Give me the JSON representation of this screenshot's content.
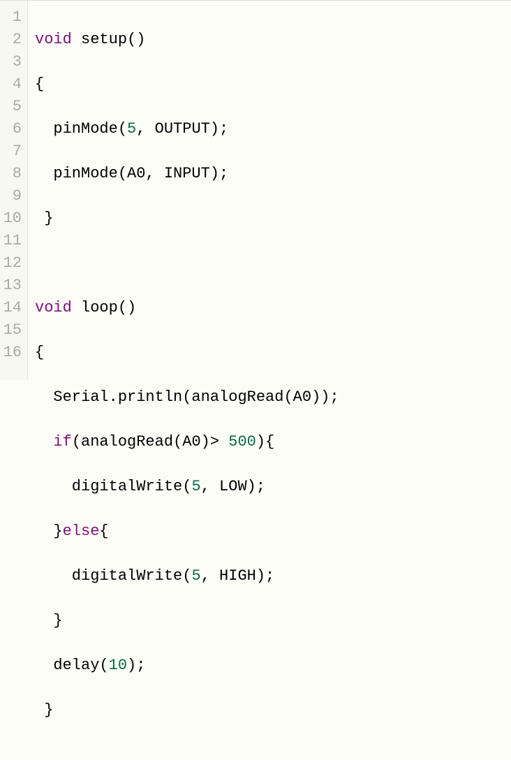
{
  "gutter": [
    "1",
    "2",
    "3",
    "4",
    "5",
    "6",
    "7",
    "8",
    "9",
    "10",
    "11",
    "12",
    "13",
    "14",
    "15",
    "16"
  ],
  "tokens": {
    "void": "void",
    "if": "if",
    "else": "else",
    "five": "5",
    "fiveHundred": "500",
    "ten": "10"
  },
  "code": {
    "l1a": " setup()",
    "l2": "{",
    "l3a": "  pinMode(",
    "l3b": ", OUTPUT);",
    "l4a": "  pinMode(A0, INPUT);",
    "l5": " }",
    "l6": "",
    "l7a": " loop()",
    "l8": "{",
    "l9": "  Serial.println(analogRead(A0));",
    "l10a": "  ",
    "l10b": "(analogRead(A0)> ",
    "l10c": "){",
    "l11a": "    digitalWrite(",
    "l11b": ", LOW);",
    "l12a": "  }",
    "l12b": "{",
    "l13a": "    digitalWrite(",
    "l13b": ", HIGH);",
    "l14": "  }",
    "l15a": "  delay(",
    "l15b": ");",
    "l16": " }"
  }
}
